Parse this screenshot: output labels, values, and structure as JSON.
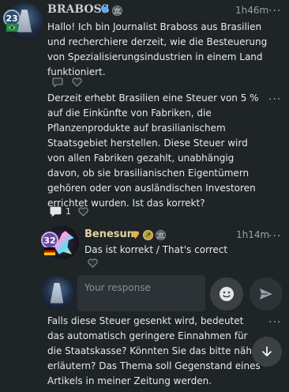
{
  "post1": {
    "level": "23",
    "author": "BRABOSS",
    "time": "1h46m",
    "more": "...",
    "text": "Hallo! Ich bin Journalist Braboss aus Brasilien und recherchiere derzeit, wie die Besteuerung von Spezialisierungsindustrien in einem Land funktioniert."
  },
  "post2": {
    "more": "...",
    "text": "Derzeit erhebt Brasilien eine Steuer von 5 % auf die Einkünfte von Fabriken, die Pflanzenprodukte auf brasilianischem Staatsgebiet herstellen. Diese Steuer wird von allen Fabriken gezahlt, unabhängig davon, ob sie brasilianischen Eigentümern gehören oder von ausländischen Investoren errichtet wurden. Ist das korrekt?",
    "comment_count": "1"
  },
  "reply": {
    "level": "32",
    "author": "Benesum",
    "time": "1h14m",
    "more": "...",
    "text": "Das ist korrekt / That's correct"
  },
  "composer": {
    "placeholder": "Your response"
  },
  "post3": {
    "more": "...",
    "text": "Falls diese Steuer gesenkt wird, bedeutet das automatisch geringere Einnahmen für die Staatskasse? Könnten Sie das bitte näher erläutern? Das Thema soll Gegenstand eines Artikels in meiner Zeitung werden."
  },
  "colors": {
    "background": "#1f2426",
    "author_braboss": "#c9cbd3",
    "author_benesum": "#e2d6a0",
    "input": "#2c3236"
  }
}
